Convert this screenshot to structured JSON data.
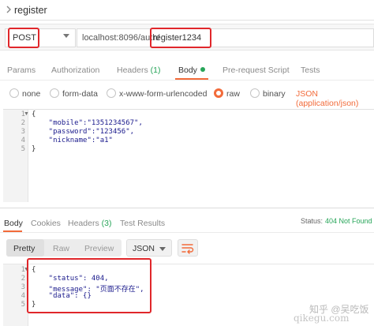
{
  "request": {
    "name": "register",
    "method": "POST",
    "url_base": "localhost:8096/auth/",
    "url_endpoint": "register1234"
  },
  "request_tabs": [
    {
      "label": "Params"
    },
    {
      "label": "Authorization"
    },
    {
      "label": "Headers",
      "count": "(1)"
    },
    {
      "label": "Body"
    },
    {
      "label": "Pre-request Script"
    },
    {
      "label": "Tests"
    }
  ],
  "body_types": [
    "none",
    "form-data",
    "x-www-form-urlencoded",
    "raw",
    "binary"
  ],
  "selected_body_type": "raw",
  "content_type": "JSON (application/json)",
  "request_body": {
    "lines": [
      "{",
      "    \"mobile\":\"1351234567\",",
      "    \"password\":\"123456\",",
      "    \"nickname\":\"a1\"",
      "}"
    ],
    "line_numbers": [
      "1",
      "2",
      "3",
      "4",
      "5"
    ]
  },
  "response_tabs": [
    {
      "label": "Body"
    },
    {
      "label": "Cookies"
    },
    {
      "label": "Headers",
      "count": "(3)"
    },
    {
      "label": "Test Results"
    }
  ],
  "status": {
    "label": "Status:",
    "value": "404 Not Found"
  },
  "view_modes": [
    "Pretty",
    "Raw",
    "Preview"
  ],
  "format": "JSON",
  "response_body": {
    "lines": [
      "{",
      "    \"status\": 404,",
      "    \"message\": \"页面不存在\",",
      "    \"data\": {}",
      "}"
    ],
    "line_numbers": [
      "1",
      "2",
      "3",
      "4",
      "5"
    ]
  },
  "watermark": {
    "line1": "知乎 @吴吃饭",
    "line2": "qikegu.com"
  },
  "colors": {
    "accent": "#f26b3a",
    "highlight": "#e0272b",
    "success": "#27a559"
  }
}
